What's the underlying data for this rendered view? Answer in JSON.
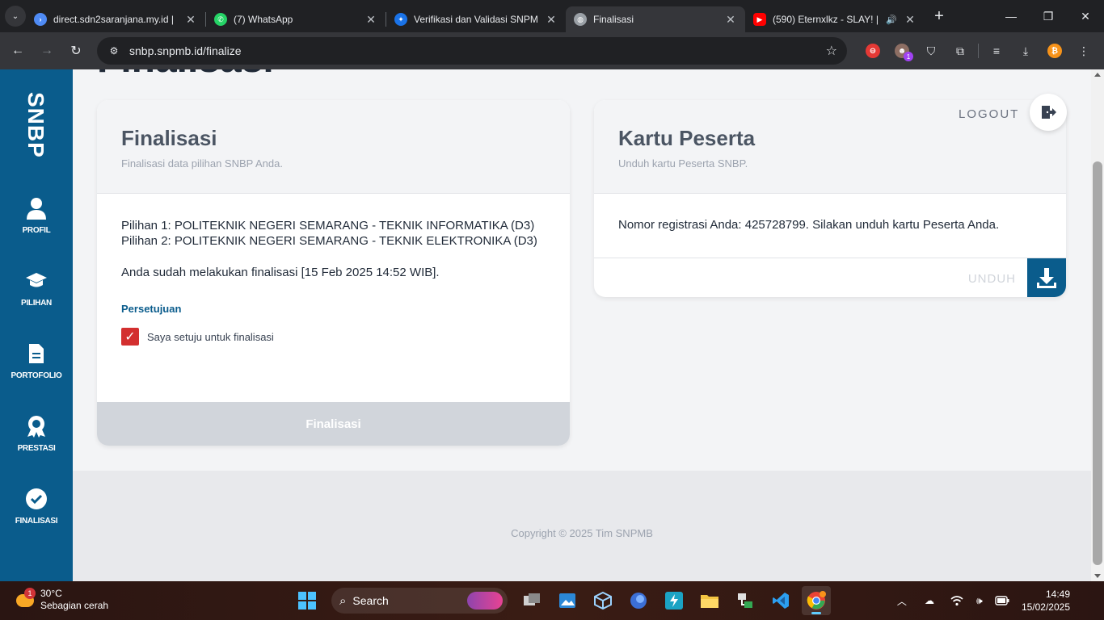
{
  "browser": {
    "tabs": [
      {
        "title": "direct.sdn2saranjana.my.id |",
        "icon_color": "#4f8bf5"
      },
      {
        "title": "(7) WhatsApp",
        "icon_color": "#25d366"
      },
      {
        "title": "Verifikasi dan Validasi SNPM",
        "icon_color": "#1a73e8"
      },
      {
        "title": "Finalisasi",
        "icon_color": "#9aa0a6"
      },
      {
        "title": "(590) Eternxlkz - SLAY! |",
        "icon_color": "#ff0000"
      }
    ],
    "url": "snbp.snpmb.id/finalize",
    "extension_badge": "1"
  },
  "sidebar": {
    "brand": "SNBP",
    "items": [
      {
        "label": "PROFIL",
        "icon": "user-icon"
      },
      {
        "label": "PILIHAN",
        "icon": "graduation-cap-icon"
      },
      {
        "label": "PORTOFOLIO",
        "icon": "document-icon"
      },
      {
        "label": "PRESTASI",
        "icon": "award-icon"
      },
      {
        "label": "FINALISASI",
        "icon": "check-circle-icon"
      }
    ],
    "color": "#0a5c8c"
  },
  "page": {
    "hero_title": "Finalisasi",
    "logout_label": "LOGOUT",
    "finalisasi_card": {
      "title": "Finalisasi",
      "subtitle": "Finalisasi data pilihan SNBP Anda.",
      "choice1": "Pilihan 1: POLITEKNIK NEGERI SEMARANG - TEKNIK INFORMATIKA (D3)",
      "choice2": "Pilihan 2: POLITEKNIK NEGERI SEMARANG - TEKNIK ELEKTRONIKA (D3)",
      "status": "Anda sudah melakukan finalisasi [15 Feb 2025 14:52 WIB].",
      "consent_title": "Persetujuan",
      "consent_label": "Saya setuju untuk finalisasi",
      "button_label": "Finalisasi"
    },
    "kartu_card": {
      "title": "Kartu Peserta",
      "subtitle": "Unduh kartu Peserta SNBP.",
      "message": "Nomor registrasi Anda: 425728799. Silakan unduh kartu Peserta Anda.",
      "download_label": "UNDUH"
    },
    "copyright": "Copyright © 2025 Tim SNPMB"
  },
  "taskbar": {
    "weather_temp": "30°C",
    "weather_desc": "Sebagian cerah",
    "weather_badge": "1",
    "search_label": "Search",
    "time": "14:49",
    "date": "15/02/2025"
  }
}
